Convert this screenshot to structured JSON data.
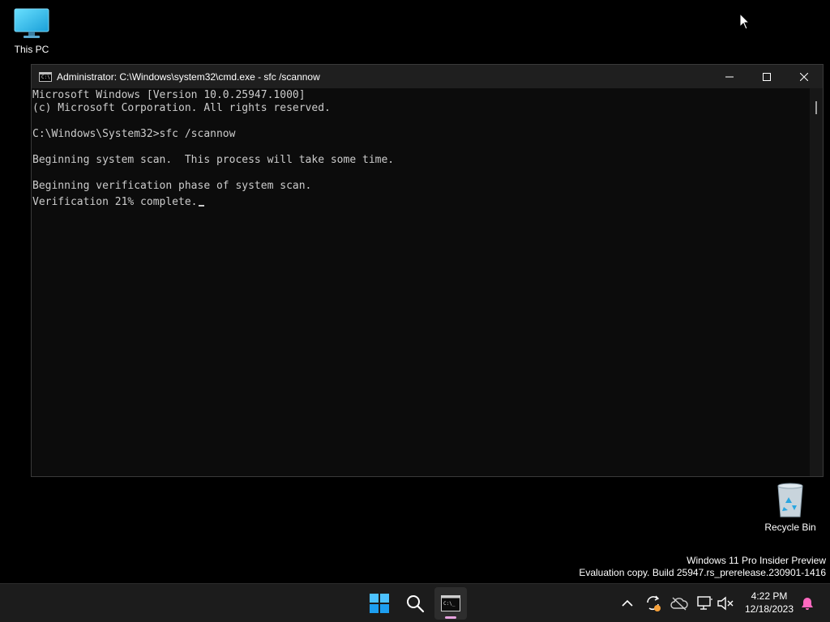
{
  "desktop": {
    "icons": [
      {
        "label": "This PC"
      },
      {
        "label": "Recycle Bin"
      }
    ],
    "watermark": {
      "line1": "Windows 11 Pro Insider Preview",
      "line2": "Evaluation copy. Build 25947.rs_prerelease.230901-1416"
    }
  },
  "window": {
    "title": "Administrator: C:\\Windows\\system32\\cmd.exe - sfc  /scannow",
    "icon": "cmd-icon",
    "controls": [
      "minimize-icon",
      "maximize-icon",
      "close-icon"
    ],
    "console_lines": [
      "Microsoft Windows [Version 10.0.25947.1000]",
      "(c) Microsoft Corporation. All rights reserved.",
      "",
      "C:\\Windows\\System32>sfc /scannow",
      "",
      "Beginning system scan.  This process will take some time.",
      "",
      "Beginning verification phase of system scan.",
      "Verification 21% complete."
    ]
  },
  "taskbar": {
    "apps": [
      "windows-start-icon",
      "search-icon",
      "terminal-icon"
    ],
    "tray": [
      "chevron-up-icon",
      "sync-icon",
      "cloud-offline-icon",
      "network-icon",
      "volume-muted-icon",
      "notification-bell-icon"
    ],
    "clock": {
      "time": "4:22 PM",
      "date": "12/18/2023"
    }
  },
  "colors": {
    "accent_start": "#4cc2ff",
    "console_text": "#cccccc",
    "console_bg": "#0c0c0c",
    "bell": "#ff69c0",
    "sync_badge": "#f7a13a"
  }
}
